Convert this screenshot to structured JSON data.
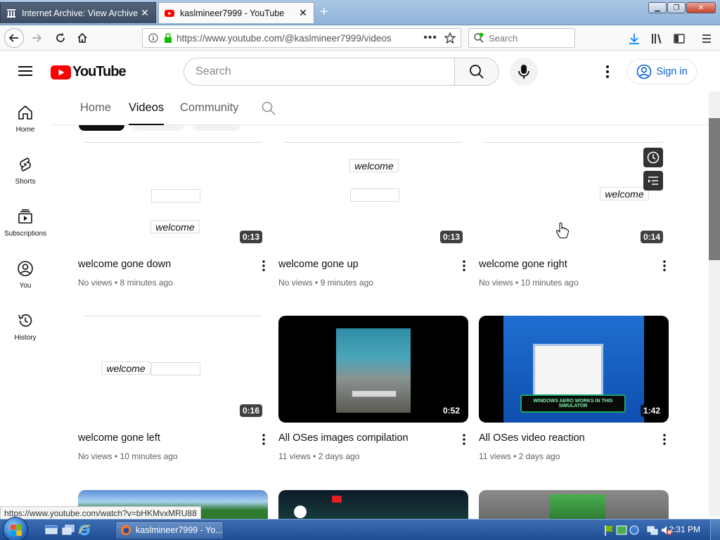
{
  "browser": {
    "tabs": [
      {
        "label": "Internet Archive: View Archive",
        "active": false
      },
      {
        "label": "kaslmineer7999 - YouTube",
        "active": true
      }
    ],
    "url": "https://www.youtube.com/@kaslmineer7999/videos",
    "search_placeholder": "Search"
  },
  "youtube": {
    "logo_text": "YouTube",
    "search_placeholder": "Search",
    "signin_label": "Sign in",
    "sidebar": [
      {
        "label": "Home",
        "icon": "home-icon"
      },
      {
        "label": "Shorts",
        "icon": "shorts-icon"
      },
      {
        "label": "Subscriptions",
        "icon": "subscriptions-icon"
      },
      {
        "label": "You",
        "icon": "you-icon"
      },
      {
        "label": "History",
        "icon": "history-icon"
      }
    ],
    "channel_tabs": [
      "Home",
      "Videos",
      "Community"
    ],
    "active_tab": "Videos",
    "videos": [
      {
        "title": "welcome gone down",
        "views": "No views",
        "age": "8 minutes ago",
        "duration": "0:13",
        "thumb_text": "welcome"
      },
      {
        "title": "welcome gone up",
        "views": "No views",
        "age": "9 minutes ago",
        "duration": "0:13",
        "thumb_text": "welcome"
      },
      {
        "title": "welcome gone right",
        "views": "No views",
        "age": "10 minutes ago",
        "duration": "0:14",
        "thumb_text": "welcome"
      },
      {
        "title": "welcome gone left",
        "views": "No views",
        "age": "10 minutes ago",
        "duration": "0:16",
        "thumb_text": "welcome"
      },
      {
        "title": "All OSes images compilation",
        "views": "11 views",
        "age": "2 days ago",
        "duration": "0:52",
        "thumb_text": ""
      },
      {
        "title": "All OSes video reaction",
        "views": "11 views",
        "age": "2 days ago",
        "duration": "1:42",
        "thumb_text": "WINDOWS AERO WORKS IN THIS SIMULATOR"
      }
    ],
    "meta_separator": " • "
  },
  "status_url": "https://www.youtube.com/watch?v=bHKMvxMRU88",
  "taskbar": {
    "window_label": "kaslmineer7999 - Yo...",
    "clock": "2:31 PM"
  },
  "colors": {
    "youtube_red": "#ff0000",
    "signin_blue": "#065fd4",
    "taskbar_blue": "#245aa0"
  }
}
